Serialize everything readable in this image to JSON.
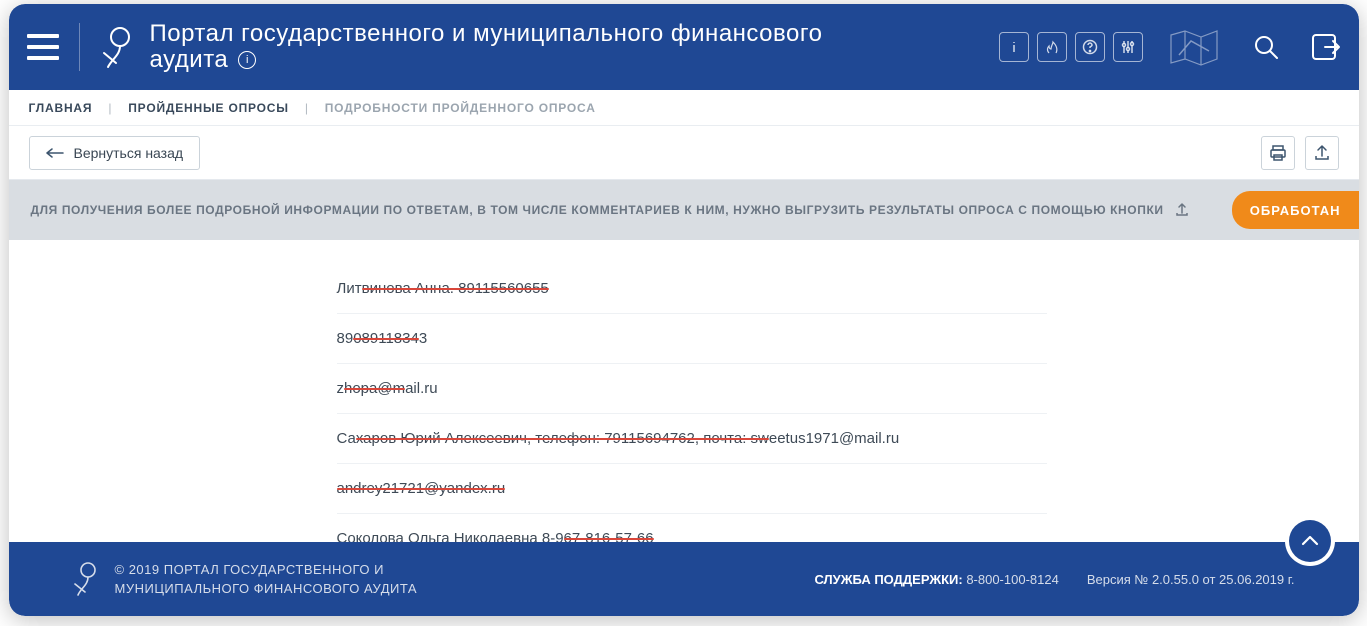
{
  "header": {
    "title_line1": "Портал государственного и муниципального финансового",
    "title_line2": "аудита",
    "icons": {
      "info": "info-icon",
      "flame": "flame-icon",
      "help": "help-icon",
      "settings": "sliders-icon",
      "map": "map-icon",
      "search": "search-icon",
      "exit": "exit-icon"
    }
  },
  "breadcrumb": {
    "home": "ГЛАВНАЯ",
    "surveys": "ПРОЙДЕННЫЕ ОПРОСЫ",
    "current": "ПОДРОБНОСТИ ПРОЙДЕННОГО ОПРОСА"
  },
  "actions": {
    "back_label": "Вернуться назад"
  },
  "notice": {
    "text": "ДЛЯ ПОЛУЧЕНИЯ БОЛЕЕ ПОДРОБНОЙ ИНФОРМАЦИИ ПО ОТВЕТАМ, В ТОМ ЧИСЛЕ КОММЕНТАРИЕВ К НИМ, НУЖНО ВЫГРУЗИТЬ РЕЗУЛЬТАТЫ ОПРОСА С ПОМОЩЬЮ КНОПКИ",
    "status_badge": "ОБРАБОТАН"
  },
  "answers": [
    {
      "pre": "Лит",
      "red": "винова Анна. 89115560655",
      "post": ""
    },
    {
      "pre": "89",
      "red": "08911834",
      "post": "3"
    },
    {
      "pre": "z",
      "red": "hopa@m",
      "post": "ail.ru"
    },
    {
      "pre": "Са",
      "red": "харов Юрий Алексеевич, телефон: 79115694762, почта: sw",
      "post": "eetus1971@mail.ru"
    },
    {
      "pre": "",
      "red": "andrey21721@yandex.ru",
      "post": ""
    },
    {
      "pre": "Соколова Ольга Николаевна 8-9",
      "red": "67-816-57-66",
      "post": ""
    }
  ],
  "footer": {
    "copy_line1": "© 2019 ПОРТАЛ ГОСУДАРСТВЕННОГО И",
    "copy_line2": "МУНИЦИПАЛЬНОГО ФИНАНСОВОГО АУДИТА",
    "support_label": "СЛУЖБА ПОДДЕРЖКИ:",
    "support_phone": "8-800-100-8124",
    "version": "Версия № 2.0.55.0 от 25.06.2019 г."
  }
}
